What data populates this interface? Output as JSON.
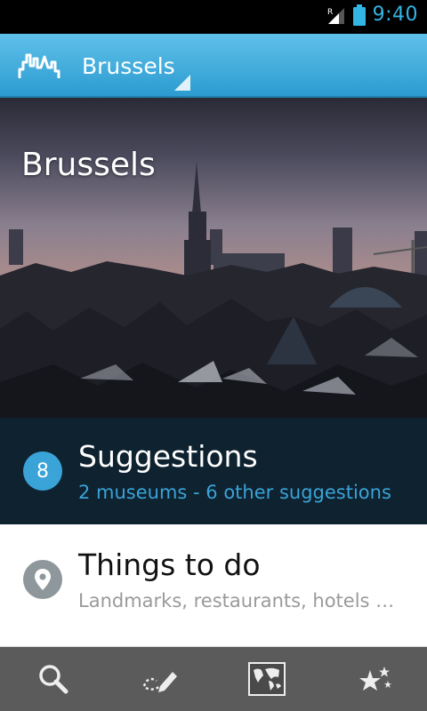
{
  "status_bar": {
    "time": "9:40",
    "roaming_indicator": "R",
    "icons": [
      "signal-icon",
      "battery-icon"
    ]
  },
  "action_bar": {
    "city": "Brussels",
    "icons": [
      "app-logo-icon"
    ]
  },
  "hero": {
    "title": "Brussels"
  },
  "suggestions": {
    "count": "8",
    "title": "Suggestions",
    "subtitle": "2 museums - 6 other suggestions"
  },
  "things_to_do": {
    "title": "Things to do",
    "subtitle": "Landmarks, restaurants, hotels …",
    "icon": "location-pin-icon"
  },
  "bottom_tabs": [
    {
      "icon": "search-icon"
    },
    {
      "icon": "edit-route-icon"
    },
    {
      "icon": "world-map-icon"
    },
    {
      "icon": "favorite-stars-icon"
    }
  ],
  "colors": {
    "accent": "#33b5e5",
    "action_bar": "#3aa6d8",
    "suggestions_bg": "#0e2230",
    "badge": "#3aa3d7",
    "bottom_bar": "#5b5b5b"
  }
}
